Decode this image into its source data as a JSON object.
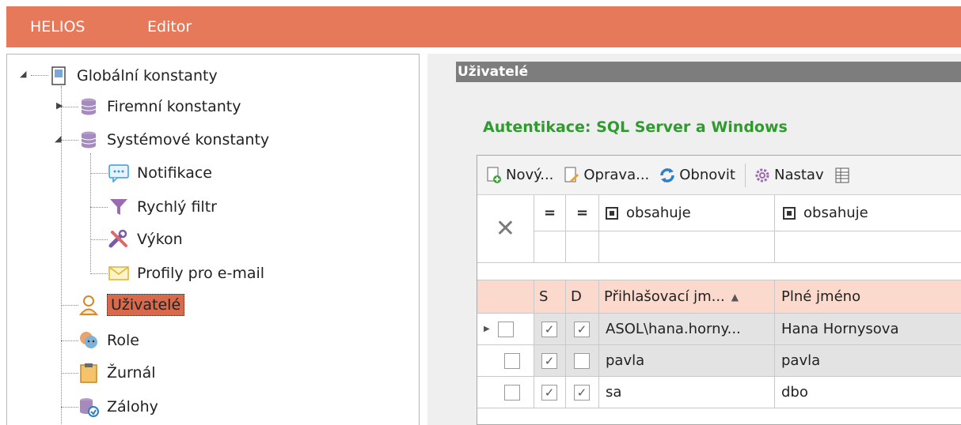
{
  "topbar": {
    "items": [
      "HELIOS",
      "Editor"
    ],
    "color": "#e5795a"
  },
  "tree": {
    "root": {
      "label": "Globální konstanty",
      "icon": "document-icon"
    },
    "items": [
      {
        "label": "Firemní konstanty",
        "icon": "database-icon"
      },
      {
        "label": "Systémové konstanty",
        "icon": "database-icon"
      },
      {
        "label": "Notifikace",
        "icon": "chat-bubble-icon"
      },
      {
        "label": "Rychlý filtr",
        "icon": "funnel-icon"
      },
      {
        "label": "Výkon",
        "icon": "tools-icon"
      },
      {
        "label": "Profily pro e-mail",
        "icon": "envelope-icon"
      },
      {
        "label": "Uživatelé",
        "icon": "user-icon"
      },
      {
        "label": "Role",
        "icon": "masks-icon"
      },
      {
        "label": "Žurnál",
        "icon": "clipboard-icon"
      },
      {
        "label": "Zálohy",
        "icon": "backup-database-icon"
      }
    ]
  },
  "main": {
    "section_title": "Uživatelé",
    "auth_label": "Autentikace: SQL Server a Windows",
    "toolbar": {
      "new_label": "Nový...",
      "edit_label": "Oprava...",
      "refresh_label": "Obnovit",
      "settings_label": "Nastav"
    },
    "filter": {
      "eq1": "=",
      "eq2": "=",
      "login_op": "obsahuje",
      "name_op": "obsahuje"
    },
    "columns": {
      "s": "S",
      "d": "D",
      "login": "Přihlašovací jm...",
      "name": "Plné jméno",
      "sort_indicator": "▲"
    },
    "rows": [
      {
        "selected": false,
        "s": true,
        "d": true,
        "login": "ASOL\\hana.horny...",
        "name": "Hana Hornysova"
      },
      {
        "selected": false,
        "s": true,
        "d": false,
        "login": "pavla",
        "name": "pavla"
      },
      {
        "selected": false,
        "s": true,
        "d": true,
        "login": "sa",
        "name": "dbo"
      }
    ]
  }
}
